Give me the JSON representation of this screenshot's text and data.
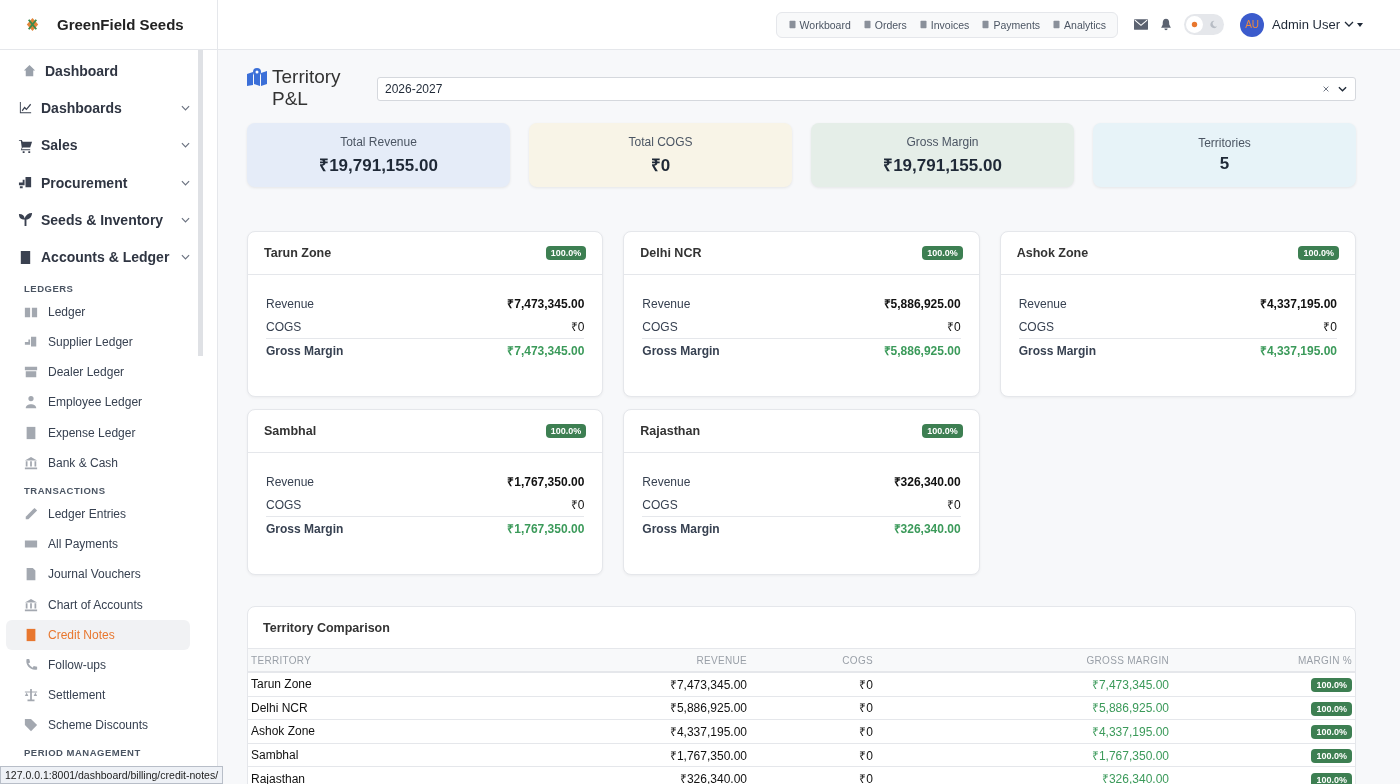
{
  "brand": {
    "name": "GreenField Seeds"
  },
  "header": {
    "nav": [
      {
        "label": "Workboard"
      },
      {
        "label": "Orders"
      },
      {
        "label": "Invoices"
      },
      {
        "label": "Payments"
      },
      {
        "label": "Analytics"
      }
    ],
    "dark_mode": false,
    "user": {
      "initials": "AU",
      "name": "Admin User"
    }
  },
  "sidebar": {
    "items": [
      {
        "label": "Dashboard",
        "kind": "link"
      },
      {
        "label": "Dashboards",
        "kind": "group"
      },
      {
        "label": "Sales",
        "kind": "group"
      },
      {
        "label": "Procurement",
        "kind": "group"
      },
      {
        "label": "Seeds & Inventory",
        "kind": "group"
      },
      {
        "label": "Accounts & Ledger",
        "kind": "group"
      }
    ],
    "sections": [
      {
        "heading": "LEDGERS",
        "items": [
          {
            "label": "Ledger",
            "selected": false
          },
          {
            "label": "Supplier Ledger",
            "selected": false
          },
          {
            "label": "Dealer Ledger",
            "selected": false
          },
          {
            "label": "Employee Ledger",
            "selected": false
          },
          {
            "label": "Expense Ledger",
            "selected": false
          },
          {
            "label": "Bank & Cash",
            "selected": false
          }
        ]
      },
      {
        "heading": "TRANSACTIONS",
        "items": [
          {
            "label": "Ledger Entries",
            "selected": false
          },
          {
            "label": "All Payments",
            "selected": false
          },
          {
            "label": "Journal Vouchers",
            "selected": false
          },
          {
            "label": "Chart of Accounts",
            "selected": false
          },
          {
            "label": "Credit Notes",
            "selected": true
          },
          {
            "label": "Follow-ups",
            "selected": false
          },
          {
            "label": "Settlement",
            "selected": false
          },
          {
            "label": "Scheme Discounts",
            "selected": false
          }
        ]
      },
      {
        "heading": "PERIOD MANAGEMENT"
      }
    ]
  },
  "page": {
    "title": "Territory P&L",
    "filter": {
      "value": "2026-2027"
    }
  },
  "stats": [
    {
      "label": "Total Revenue",
      "value": "₹19,791,155.00",
      "color": "#e5ecf8"
    },
    {
      "label": "Total COGS",
      "value": "₹0",
      "color": "#f8f4e7"
    },
    {
      "label": "Gross Margin",
      "value": "₹19,791,155.00",
      "color": "#e5eee8"
    },
    {
      "label": "Territories",
      "value": "5",
      "color": "#e7f3f8"
    }
  ],
  "territories": [
    {
      "name": "Tarun Zone",
      "badge": "100.0%",
      "rows": [
        {
          "label": "Revenue",
          "value": "₹7,473,345.00"
        },
        {
          "label": "COGS",
          "value": "₹0"
        },
        {
          "label": "Gross Margin",
          "value": "₹7,473,345.00"
        }
      ]
    },
    {
      "name": "Delhi NCR",
      "badge": "100.0%",
      "rows": [
        {
          "label": "Revenue",
          "value": "₹5,886,925.00"
        },
        {
          "label": "COGS",
          "value": "₹0"
        },
        {
          "label": "Gross Margin",
          "value": "₹5,886,925.00"
        }
      ]
    },
    {
      "name": "Ashok Zone",
      "badge": "100.0%",
      "rows": [
        {
          "label": "Revenue",
          "value": "₹4,337,195.00"
        },
        {
          "label": "COGS",
          "value": "₹0"
        },
        {
          "label": "Gross Margin",
          "value": "₹4,337,195.00"
        }
      ]
    },
    {
      "name": "Sambhal",
      "badge": "100.0%",
      "rows": [
        {
          "label": "Revenue",
          "value": "₹1,767,350.00"
        },
        {
          "label": "COGS",
          "value": "₹0"
        },
        {
          "label": "Gross Margin",
          "value": "₹1,767,350.00"
        }
      ]
    },
    {
      "name": "Rajasthan",
      "badge": "100.0%",
      "rows": [
        {
          "label": "Revenue",
          "value": "₹326,340.00"
        },
        {
          "label": "COGS",
          "value": "₹0"
        },
        {
          "label": "Gross Margin",
          "value": "₹326,340.00"
        }
      ]
    }
  ],
  "comparison": {
    "title": "Territory Comparison",
    "columns": [
      "TERRITORY",
      "REVENUE",
      "COGS",
      "GROSS MARGIN",
      "MARGIN %"
    ],
    "rows": [
      [
        "Tarun Zone",
        "₹7,473,345.00",
        "₹0",
        "₹7,473,345.00",
        "100.0%"
      ],
      [
        "Delhi NCR",
        "₹5,886,925.00",
        "₹0",
        "₹5,886,925.00",
        "100.0%"
      ],
      [
        "Ashok Zone",
        "₹4,337,195.00",
        "₹0",
        "₹4,337,195.00",
        "100.0%"
      ],
      [
        "Sambhal",
        "₹1,767,350.00",
        "₹0",
        "₹1,767,350.00",
        "100.0%"
      ],
      [
        "Rajasthan",
        "₹326,340.00",
        "₹0",
        "₹326,340.00",
        "100.0%"
      ]
    ]
  },
  "status_bar": {
    "url": "127.0.0.1:8001/dashboard/billing/credit-notes/"
  }
}
